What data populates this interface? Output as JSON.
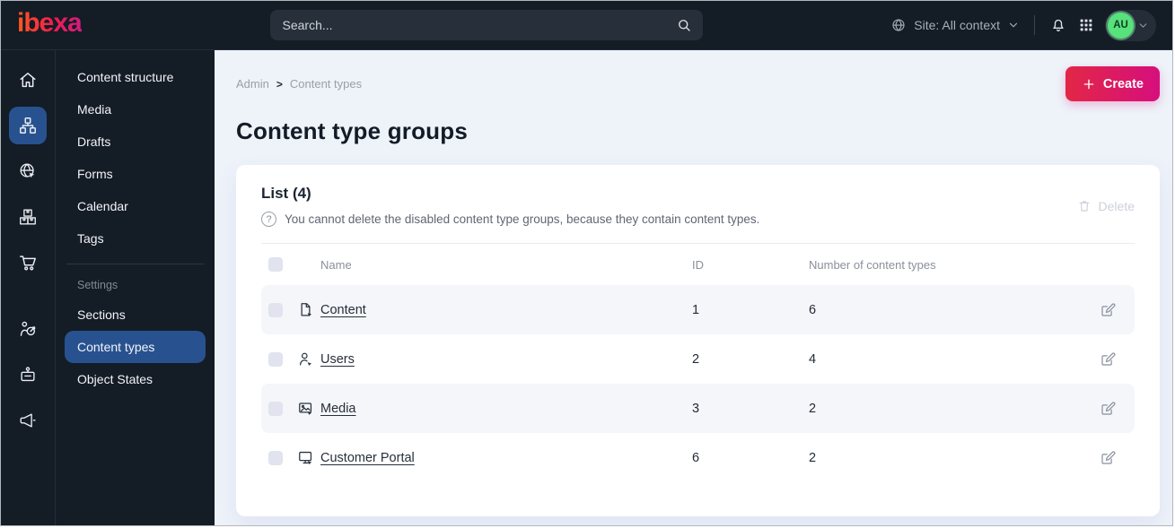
{
  "topbar": {
    "logo": "ibexa",
    "search_placeholder": "Search...",
    "site_context": "Site: All context",
    "avatar_initials": "AU"
  },
  "icon_rail": {
    "items": [
      {
        "icon": "home-icon",
        "active": false
      },
      {
        "icon": "sitemap-icon",
        "active": true
      },
      {
        "icon": "globe-cursor-icon",
        "active": false
      },
      {
        "icon": "boxes-icon",
        "active": false
      },
      {
        "icon": "cart-icon",
        "active": false
      },
      {
        "icon": "target-user-icon",
        "active": false
      },
      {
        "icon": "briefcase-icon",
        "active": false
      },
      {
        "icon": "megaphone-icon",
        "active": false
      }
    ]
  },
  "sidebar": {
    "items": [
      "Content structure",
      "Media",
      "Drafts",
      "Forms",
      "Calendar",
      "Tags"
    ],
    "settings_header": "Settings",
    "settings_items": [
      "Sections",
      "Content types",
      "Object States"
    ],
    "active_item": "Content types"
  },
  "breadcrumb": {
    "items": [
      "Admin",
      "Content types"
    ],
    "separator": ">"
  },
  "page": {
    "title": "Content type groups",
    "create_button": "Create"
  },
  "panel": {
    "title": "List (4)",
    "info": "You cannot delete the disabled content type groups, because they contain content types.",
    "delete_button": "Delete"
  },
  "table": {
    "columns": {
      "name": "Name",
      "id": "ID",
      "count": "Number of content types"
    },
    "rows": [
      {
        "icon": "content-file-icon",
        "name": "Content",
        "id": "1",
        "count": "6"
      },
      {
        "icon": "users-icon",
        "name": "Users",
        "id": "2",
        "count": "4"
      },
      {
        "icon": "media-image-icon",
        "name": "Media",
        "id": "3",
        "count": "2"
      },
      {
        "icon": "monitor-icon",
        "name": "Customer Portal",
        "id": "6",
        "count": "2"
      }
    ]
  },
  "colors": {
    "topbar_bg": "#141c26",
    "active_blue": "#28528f",
    "accent_start": "#e22746",
    "accent_end": "#d60f7d",
    "avatar_green": "#57e27c",
    "page_bg": "#eef2f9"
  }
}
